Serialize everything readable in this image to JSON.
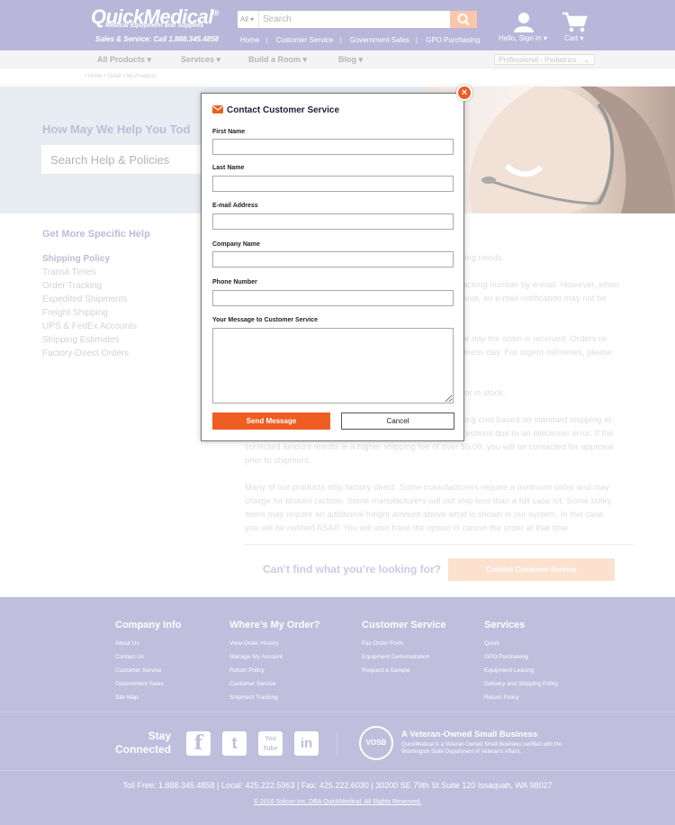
{
  "header": {
    "logo": "QuickMedical",
    "logo_mark": "®",
    "logo_sub": "Medical Equipment and Supplies",
    "phone": "Sales & Service: Call 1.888.345.4858",
    "search_scope": "All",
    "search_placeholder": "Search",
    "nav": [
      "Home",
      "Customer Service",
      "Government Sales",
      "GPO Purchasing"
    ],
    "account_label": "Hello, Sign In",
    "cart_label": "Cart",
    "brand_color": "#7e7cbc",
    "accent_color": "#f79764"
  },
  "navbar": {
    "items": [
      "All Products",
      "Services",
      "Build a Room",
      "Blog"
    ],
    "select_value": "Professional - Pediatrics"
  },
  "breadcrumbs": "• Home • Qclub • My Products",
  "hero": {
    "title": "How May We Help You Tod",
    "search_placeholder": "Search Help & Policies"
  },
  "left_panel": {
    "title": "Get More Specific Help",
    "items": [
      "Shipping Policy",
      "Transit Times",
      "Order Tracking",
      "Expedited Shipments",
      "Freight Shipping",
      "UPS & FedEx Accounts",
      "Shipping Estimates",
      "Factory-Direct Orders"
    ]
  },
  "content": {
    "p1": "ping needs.",
    "p2a": "racking number by e-mail. However, when",
    "p2b": "ouse, an e-mail notification may not be",
    "p3a": "he day the order is received. Orders re-",
    "p3b": "siness day. For urgent deliveries, please",
    "p4": "not in stock.",
    "p5a": "ping cost based on standard shipping al-",
    "p5b": "rrections due to an electronic error. If the",
    "p5c": "corrected amount results in a higher shipping fee of over $5.00, you will be contacted for approval",
    "p5d": "prior to shipment.",
    "p6a": "Many of our products ship factory direct. Some manufacturers require a minimum order and may",
    "p6b": "charge for broken cartons. Some manufacturers will not ship less than a full case lot. Some bulky",
    "p6c": "items may require an additional freight amount above what is shown in our system. In this case",
    "p6d": "you will be notified ASAP. You will also have the option to cancel the order at that time.",
    "cant_find": "Can’t find what you’re looking for?",
    "cta": "Contact Customer Service"
  },
  "footer": {
    "columns": [
      {
        "title": "Company Info",
        "links": [
          "About Us",
          "Contact Us",
          "Customer Service",
          "Government Sales",
          "Site Map"
        ]
      },
      {
        "title": "Where’s My Order?",
        "links": [
          "View Order History",
          "Manage My Account",
          "Return Policy",
          "Customer Service",
          "Shipment Tracking"
        ]
      },
      {
        "title": "Customer Service",
        "links": [
          "Fax Order Form",
          "Equipment Demonstration",
          "Request a Sample"
        ]
      },
      {
        "title": "Services",
        "links": [
          "Qclub",
          "GPO Purchasing",
          "Equipment Leasing",
          "Delivery and Shipping Policy",
          "Return Policy"
        ]
      }
    ],
    "stay_line1": "Stay",
    "stay_line2": "Connected",
    "social": [
      {
        "icon": "facebook-icon",
        "glyph": "f"
      },
      {
        "icon": "twitter-icon",
        "glyph": "t"
      },
      {
        "icon": "youtube-icon",
        "glyph": "You Tube"
      },
      {
        "icon": "linkedin-icon",
        "glyph": "in"
      }
    ],
    "vosb_badge": "VOSB",
    "veteran_title": "A Veteran-Owned Small Business",
    "veteran_sub": "QuickMedical is a Veteran-Owned Small Business certified with the Washington State Department of Veteran's Affairs.",
    "contact_line": "Toll Free: 1.888.345.4858  |  Local: 425.222.5963  |  Fax: 425.222.6030  |  30200 SE 79th St Suite 120 Issaquah, WA 98027",
    "copyright": "© 2016 Solcon Inc. DBA QuickMedical. All Rights Reserved."
  },
  "modal": {
    "title": "Contact Customer Service",
    "close_glyph": "×",
    "fields": [
      {
        "label": "First Name",
        "value": ""
      },
      {
        "label": "Last Name",
        "value": ""
      },
      {
        "label": "E-mail Address",
        "value": ""
      },
      {
        "label": "Company Name",
        "value": ""
      },
      {
        "label": "Phone Number",
        "value": ""
      }
    ],
    "message_label": "Your Message to Customer Service",
    "send_label": "Send Message",
    "cancel_label": "Cancel",
    "accent_color": "#f05d22"
  }
}
